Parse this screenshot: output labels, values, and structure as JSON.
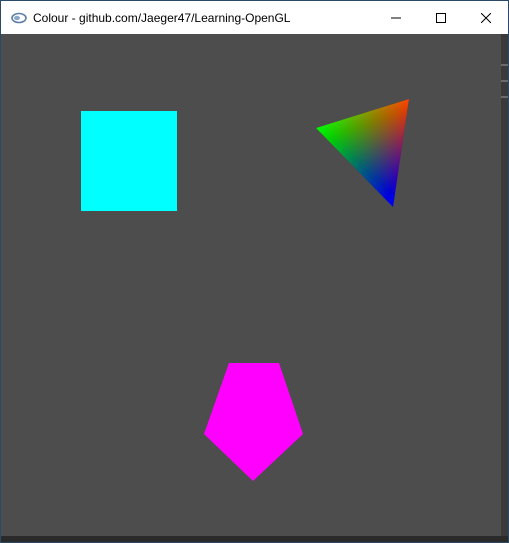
{
  "window": {
    "title": "Colour - github.com/Jaeger47/Learning-OpenGL"
  },
  "titlebar": {
    "app_icon": "opengl-app-icon",
    "buttons": [
      {
        "name": "minimize",
        "icon": "minimize-icon"
      },
      {
        "name": "maximize",
        "icon": "maximize-icon"
      },
      {
        "name": "close",
        "icon": "close-icon"
      }
    ]
  },
  "scene": {
    "background_color": "#4d4d4d",
    "shapes": [
      {
        "name": "square",
        "color": "#00ffff"
      },
      {
        "name": "triangle",
        "vertex_colors": [
          "#ff0000",
          "#00ff00",
          "#0000ff"
        ]
      },
      {
        "name": "pentagon",
        "color": "#ff00ff"
      }
    ]
  }
}
